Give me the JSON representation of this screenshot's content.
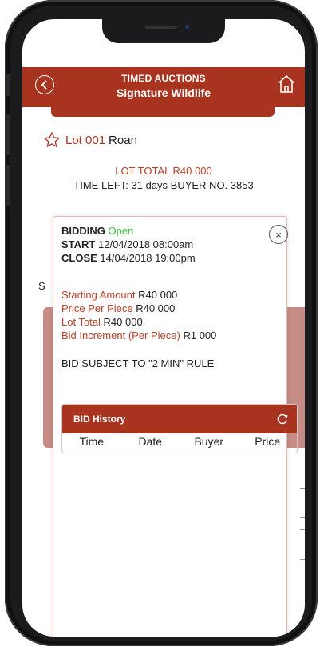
{
  "header": {
    "title": "TIMED AUCTIONS",
    "subtitle": "Signature Wildlife"
  },
  "lot": {
    "number": "Lot 001",
    "name": "Roan",
    "total_line": "LOT TOTAL R40 000",
    "time_line": "TIME LEFT: 31 days  BUYER NO. 3853"
  },
  "background": {
    "s_label": "S"
  },
  "modal": {
    "bidding_label": "BIDDING",
    "bidding_status": "Open",
    "start_label": "START",
    "start_value": "12/04/2018 08:00am",
    "close_label": "CLOSE",
    "close_value": "14/04/2018 19:00pm",
    "close_symbol": "×",
    "starting_amount_label": "Starting Amount",
    "starting_amount_value": "R40 000",
    "price_per_piece_label": "Price Per Piece",
    "price_per_piece_value": "R40 000",
    "lot_total_label": "Lot Total",
    "lot_total_value": "R40 000",
    "bid_increment_label": "Bid Increment (Per Piece)",
    "bid_increment_value": "R1 000",
    "rule_text": "BID SUBJECT TO \"2 MIN\" RULE",
    "bid_history": {
      "title": "BID History",
      "columns": [
        "Time",
        "Date",
        "Buyer",
        "Price"
      ]
    }
  },
  "colors": {
    "brand": "#a8341f",
    "status_open": "#3fbf3f",
    "accent_text": "#b8412a"
  },
  "icons": {
    "back": "chevron-left-circle-icon",
    "home": "home-icon",
    "favorite": "star-outline-icon",
    "close": "close-circle-icon",
    "refresh": "refresh-icon"
  }
}
